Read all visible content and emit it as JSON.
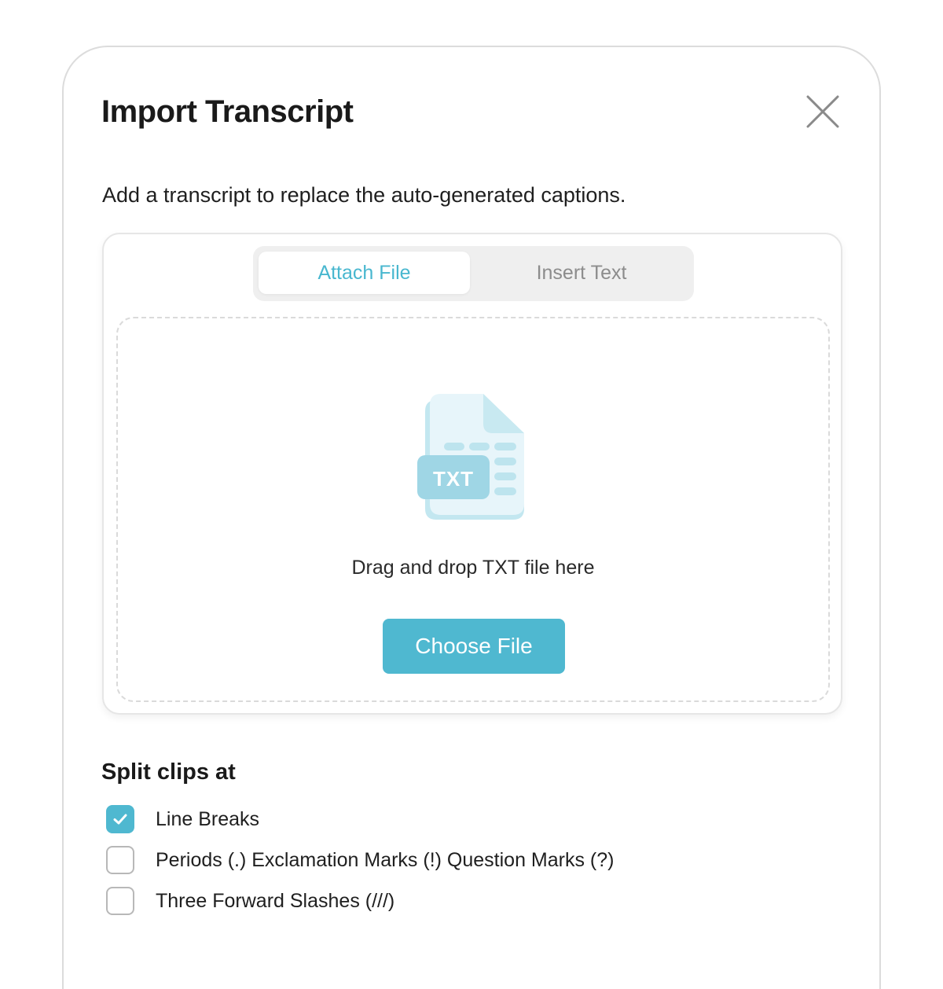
{
  "dialog": {
    "title": "Import Transcript",
    "subtitle": "Add a transcript to replace the auto-generated captions."
  },
  "tabs": [
    {
      "label": "Attach File",
      "active": true
    },
    {
      "label": "Insert Text",
      "active": false
    }
  ],
  "dropzone": {
    "icon": "txt-file-icon",
    "icon_label": "TXT",
    "drop_text": "Drag and drop TXT file here",
    "button_label": "Choose File"
  },
  "split": {
    "title": "Split clips at",
    "options": [
      {
        "label": "Line Breaks",
        "checked": true
      },
      {
        "label": "Periods (.) Exclamation Marks (!) Question Marks (?)",
        "checked": false
      },
      {
        "label": "Three Forward Slashes (///)",
        "checked": false
      }
    ]
  },
  "colors": {
    "accent": "#4fb8d0",
    "accent_text": "#48b7cf"
  }
}
